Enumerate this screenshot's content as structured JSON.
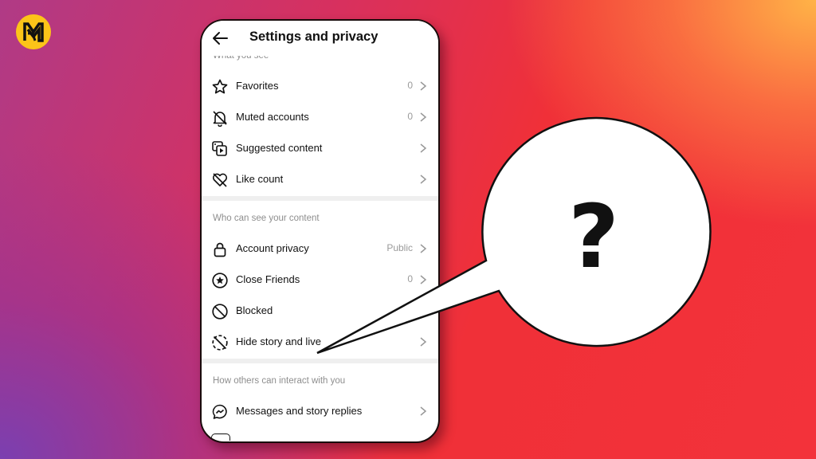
{
  "brand": {
    "logo_letters": "RM",
    "logo_color": "#fcc419"
  },
  "header": {
    "title": "Settings and privacy"
  },
  "sections": [
    {
      "label": "What you see",
      "items": [
        {
          "label": "Favorites",
          "value": "0",
          "icon": "star-icon"
        },
        {
          "label": "Muted accounts",
          "value": "0",
          "icon": "muted-bell-icon"
        },
        {
          "label": "Suggested content",
          "value": "",
          "icon": "suggested-content-icon"
        },
        {
          "label": "Like count",
          "value": "",
          "icon": "heart-off-icon"
        }
      ]
    },
    {
      "label": "Who can see your content",
      "items": [
        {
          "label": "Account privacy",
          "value": "Public",
          "icon": "lock-icon"
        },
        {
          "label": "Close Friends",
          "value": "0",
          "icon": "star-circle-icon"
        },
        {
          "label": "Blocked",
          "value": "",
          "icon": "blocked-icon"
        },
        {
          "label": "Hide story and live",
          "value": "",
          "icon": "hide-story-icon"
        }
      ]
    },
    {
      "label": "How others can interact with you",
      "items": [
        {
          "label": "Messages and story replies",
          "value": "",
          "icon": "messenger-icon"
        }
      ]
    }
  ],
  "callout": {
    "symbol": "?"
  },
  "colors": {
    "text": "#111111",
    "muted": "#8e8e8e",
    "divider": "#efefef"
  }
}
